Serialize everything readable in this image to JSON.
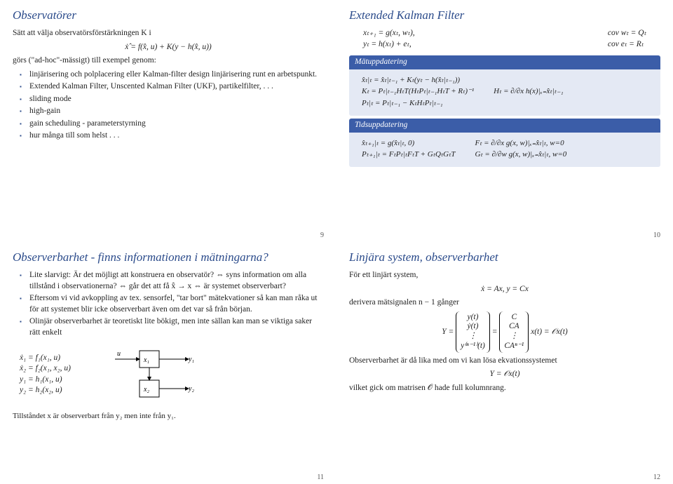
{
  "slide9": {
    "title": "Observatörer",
    "intro": "Sätt att välja observatörsförstärkningen K i",
    "eq1": "ẋ̂ = f(x̂, u) + K(y − h(x̂, u))",
    "line2": "görs (\"ad-hoc\"-mässigt) till exempel genom:",
    "items": [
      "linjärisering och polplacering eller Kalman-filter design linjärisering runt en arbetspunkt.",
      "Extended Kalman Filter, Unscented Kalman Filter (UKF), partikelfilter, . . .",
      "sliding mode",
      "high-gain",
      "gain scheduling - parameterstyrning",
      "hur många till som helst . . ."
    ],
    "page": "9"
  },
  "slide10": {
    "title": "Extended Kalman Filter",
    "eq_left": [
      "xₜ₊₁ = g(xₜ, wₜ),",
      "yₜ = h(xₜ) + eₜ,"
    ],
    "eq_right": [
      "cov wₜ = Qₜ",
      "cov eₜ = Rₜ"
    ],
    "block1_title": "Mätuppdatering",
    "block1_eqs": [
      "x̂ₜ|ₜ = x̂ₜ|ₜ₋₁ + Kₜ(yₜ − h(x̂ₜ|ₜ₋₁))",
      "Kₜ = Pₜ|ₜ₋₁HₜT(HₜPₜ|ₜ₋₁HₜT + Rₜ)⁻¹",
      "Pₜ|ₜ = Pₜ|ₜ₋₁ − KₜHₜPₜ|ₜ₋₁"
    ],
    "block1_right": "Hₜ = ∂/∂x h(x)|ₓ₌x̂ₜ|ₜ₋₁",
    "block2_title": "Tidsuppdatering",
    "block2_eqs": [
      "x̂ₜ₊₁|ₜ = g(x̂ₜ|ₜ, 0)",
      "Pₜ₊₁|ₜ = FₜPₜ|ₜFₜT + GₜQₜGₜT"
    ],
    "block2_right": [
      "Fₜ = ∂/∂x g(x, w)|ₓ₌x̂ₜ|ₜ, w=0",
      "Gₜ = ∂/∂w g(x, w)|ₓ₌x̂ₜ|ₜ, w=0"
    ],
    "page": "10"
  },
  "slide11": {
    "title": "Observerbarhet - finns informationen i mätningarna?",
    "items": [
      "Lite slarvigt: Är det möjligt att konstruera en observatör? ⇔ syns information om alla tillstånd i observationerna? ⇔ går det att få x̂ → x ⇔ är systemet observerbart?",
      "Eftersom vi vid avkoppling av tex. sensorfel, \"tar bort\" mätekvationer så kan man råka ut för att systemet blir icke observerbart även om det var så från början.",
      "Olinjär observerbarhet är teoretiskt lite bökigt, men inte sällan kan man se viktiga saker rätt enkelt"
    ],
    "eqs": [
      "ẋ₁ = f₁(x₁, u)",
      "ẋ₂ = f₂(x₁, x₂, u)",
      "y₁ = h₁(x₁, u)",
      "y₂ = h₂(x₂, u)"
    ],
    "footnote": "Tillståndet x är observerbart från y₂ men inte från y₁.",
    "page": "11"
  },
  "slide12": {
    "title": "Linjära system, observerbarhet",
    "line1": "För ett linjärt system,",
    "eq1": "ẋ = Ax,    y = Cx",
    "line2": "derivera mätsignalen n − 1 gånger",
    "Yleft": [
      "y(t)",
      "ẏ(t)",
      "⋮",
      "y⁽ⁿ⁻¹⁾(t)"
    ],
    "Yright": [
      "C",
      "CA",
      "⋮",
      "CAⁿ⁻¹"
    ],
    "eq_end": "x(t) = 𝒪x(t)",
    "line3": "Observerbarhet är då lika med om vi kan lösa ekvationssystemet",
    "eq2": "Y = 𝒪x(t)",
    "line4": "vilket gick om matrisen 𝒪 hade full kolumnrang.",
    "page": "12"
  }
}
